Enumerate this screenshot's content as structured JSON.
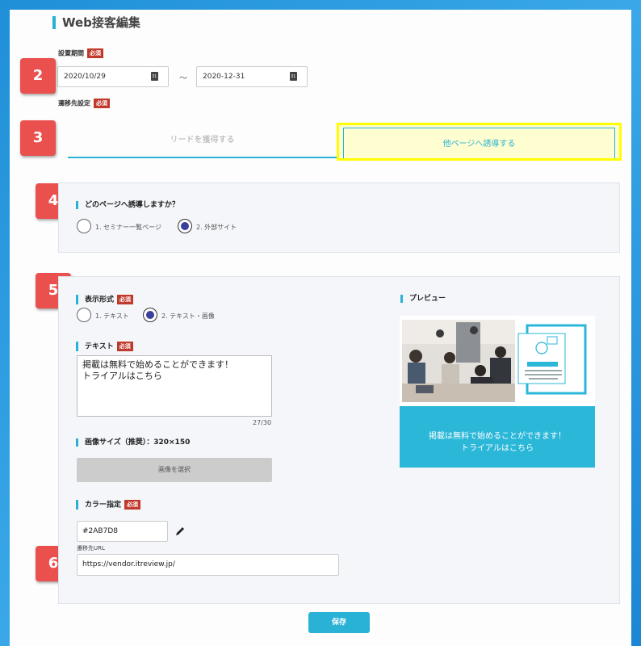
{
  "page_title": "Web接客編集",
  "period": {
    "label": "設置期間",
    "required": "必須",
    "start": "2020/10/29",
    "separator": "〜",
    "end": "2020-12-31"
  },
  "transition_setting": {
    "label": "遷移先設定",
    "required": "必須"
  },
  "tabs": [
    {
      "label": "リードを獲得する"
    },
    {
      "label": "他ページへ誘導する"
    }
  ],
  "badges": [
    "2",
    "3",
    "4",
    "5",
    "6"
  ],
  "section4": {
    "title": "どのページへ誘導しますか？",
    "options": [
      {
        "label": "1. セミナー一覧ページ",
        "checked": false
      },
      {
        "label": "2. 外部サイト",
        "checked": true
      }
    ]
  },
  "section5": {
    "display_format": {
      "title": "表示形式",
      "required": "必須",
      "options": [
        {
          "label": "1. テキスト",
          "checked": false
        },
        {
          "label": "2. テキスト・画像",
          "checked": true
        }
      ]
    },
    "text": {
      "title": "テキスト",
      "required": "必須",
      "line1": "掲載は無料で始めることができます！",
      "line2": "トライアルはこちら",
      "counter": "27/30"
    },
    "image_size": {
      "title": "画像サイズ（推奨）：320×150",
      "button": "画像を選択"
    },
    "color": {
      "title": "カラー指定",
      "required": "必須",
      "value": "#2AB7D8",
      "swatch": "#2AB7D8"
    },
    "url": {
      "label": "遷移先URL",
      "value": "https://vendor.itreview.jp/"
    },
    "preview": {
      "title": "プレビュー",
      "card_line1": "掲載は無料で始めることができます！",
      "card_line2": "トライアルはこちら",
      "card_color": "#2AB7D8"
    }
  },
  "save_button": "保存",
  "colors": {
    "accent": "#29B2D6",
    "badge": "#E9504E",
    "required": "#C0392B",
    "highlight": "#FFFF00"
  }
}
